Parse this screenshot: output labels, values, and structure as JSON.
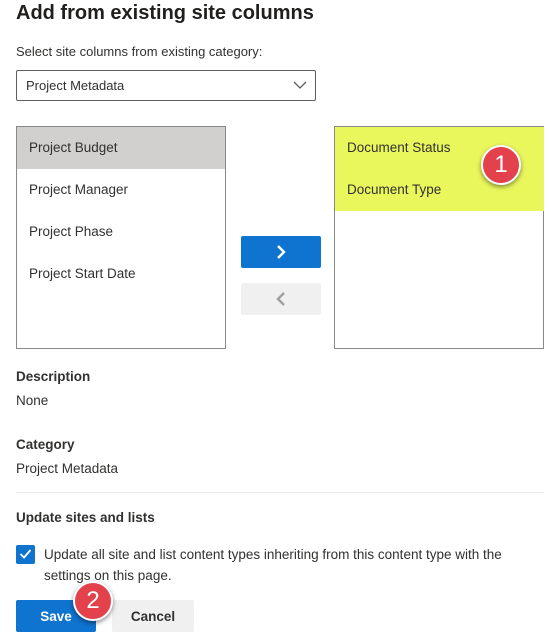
{
  "dialog": {
    "title": "Add from existing site columns",
    "subtitle": "Select site columns from existing category:"
  },
  "category_select": {
    "selected": "Project Metadata"
  },
  "available_columns": {
    "items": [
      "Project Budget",
      "Project Manager",
      "Project Phase",
      "Project Start Date"
    ],
    "selected_index": 0
  },
  "added_columns": {
    "items": [
      "Document Status",
      "Document Type"
    ],
    "highlight_color": "#e9f75c"
  },
  "move_buttons": {
    "add_icon": "chevron-right-icon",
    "remove_icon": "chevron-left-icon"
  },
  "description": {
    "label": "Description",
    "value": "None"
  },
  "category": {
    "label": "Category",
    "value": "Project Metadata"
  },
  "update": {
    "heading": "Update sites and lists",
    "checkbox_label": "Update all site and list content types inheriting from this content type with the settings on this page.",
    "checked": true
  },
  "actions": {
    "save_label": "Save",
    "cancel_label": "Cancel"
  },
  "callouts": {
    "first": "1",
    "second": "2",
    "color": "#e3414c"
  },
  "colors": {
    "accent": "#0f73d0",
    "selected_item": "#d2d0ce"
  }
}
